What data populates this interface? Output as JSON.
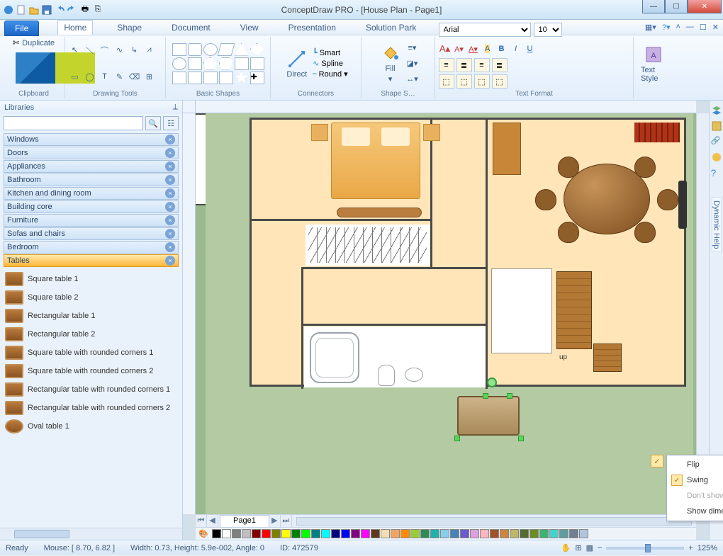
{
  "title": "ConceptDraw PRO - [House Plan - Page1]",
  "menubar": {
    "file": "File",
    "tabs": [
      "Home",
      "Shape",
      "Document",
      "View",
      "Presentation",
      "Solution Park"
    ],
    "active": 0
  },
  "ribbon": {
    "clipboard": {
      "label": "Clipboard",
      "duplicate": "Duplicate"
    },
    "drawing": {
      "label": "Drawing Tools"
    },
    "basic": {
      "label": "Basic Shapes"
    },
    "connectors": {
      "label": "Connectors",
      "direct": "Direct",
      "smart": "Smart",
      "spline": "Spline",
      "round": "Round"
    },
    "fill": {
      "label": "Shape S…",
      "fill": "Fill"
    },
    "textfmt": {
      "label": "Text Format",
      "font": "Arial",
      "size": "10"
    },
    "textstyle": {
      "label": "",
      "btn": "Text Style"
    }
  },
  "libs": {
    "title": "Libraries",
    "categories": [
      "Windows",
      "Doors",
      "Appliances",
      "Bathroom",
      "Kitchen and dining room",
      "Building core",
      "Furniture",
      "Sofas and chairs",
      "Bedroom",
      "Tables"
    ],
    "selected": "Tables",
    "shapes": [
      "Square table 1",
      "Square table 2",
      "Rectangular table 1",
      "Rectangular table 2",
      "Square table with rounded corners 1",
      "Square table with rounded corners 2",
      "Rectangular table with rounded corners 1",
      "Rectangular table with rounded corners 2",
      "Oval table 1"
    ]
  },
  "canvas": {
    "up": "up"
  },
  "context_menu": {
    "items": [
      {
        "label": "Flip",
        "check": false,
        "disabled": false
      },
      {
        "label": "Swing",
        "check": true,
        "disabled": false
      },
      {
        "label": "Don't show units",
        "check": false,
        "disabled": true
      },
      {
        "label": "Show dimensions",
        "check": false,
        "disabled": false
      }
    ]
  },
  "page_tab": "Page1",
  "status": {
    "ready": "Ready",
    "mouse": "Mouse: [ 8.70, 6.82 ]",
    "dims": "Width: 0.73,  Height: 5.9e-002,  Angle: 0",
    "id": "ID: 472579",
    "zoom": "125%"
  },
  "colors": [
    "#000",
    "#fff",
    "#7f7f7f",
    "#c0c0c0",
    "#800000",
    "#f00",
    "#808000",
    "#ff0",
    "#008000",
    "#0f0",
    "#008080",
    "#0ff",
    "#000080",
    "#00f",
    "#800080",
    "#f0f",
    "#5b3a1e",
    "#f5deb3",
    "#f4a460",
    "#ff8c00",
    "#9acd32",
    "#2e8b57",
    "#20b2aa",
    "#87ceeb",
    "#4682b4",
    "#6a5acd",
    "#dda0dd",
    "#ffb6c1",
    "#a0522d",
    "#cd853f",
    "#bdb76b",
    "#556b2f",
    "#6b8e23",
    "#3cb371",
    "#48d1cc",
    "#5f9ea0",
    "#708090",
    "#b0c4de"
  ],
  "dyn_help": "Dynamic Help"
}
